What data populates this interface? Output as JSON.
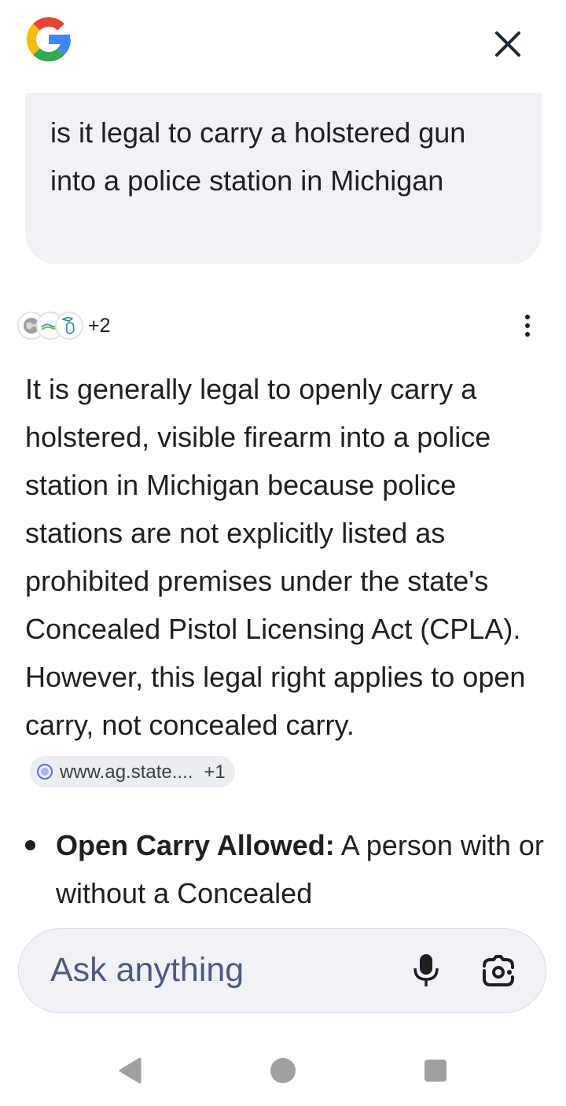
{
  "header": {
    "logo_icon": "google-g-icon",
    "close_icon": "close-icon"
  },
  "query": {
    "text": "is it legal to carry a holstered gun into a police station in Michigan"
  },
  "sources": {
    "icons": [
      "globe-icon",
      "ag-state-logo-icon",
      "michigan-map-icon"
    ],
    "extra_count": "+2"
  },
  "answer": {
    "paragraph": "It is generally legal to openly carry a holstered, visible firearm into a police station in Michigan because police stations are not explicitly listed as prohibited premises under the state's Concealed Pistol Licensing Act (CPLA). However, this legal right applies to open carry, not concealed carry.",
    "citation": {
      "label": "www.ag.state....",
      "extra": "+1"
    }
  },
  "bullets": [
    {
      "heading": "Open Carry Allowed:",
      "text": " A person with or without a Concealed"
    }
  ],
  "input": {
    "placeholder": "Ask anything",
    "mic_icon": "microphone-icon",
    "lens_icon": "google-lens-icon"
  },
  "navigation": {
    "back_icon": "back-triangle-icon",
    "home_icon": "home-circle-icon",
    "recents_icon": "recents-square-icon"
  },
  "colors": {
    "bubble_bg": "#f0f2f7",
    "chip_bg": "#eaedf2",
    "placeholder_text": "#4f5a80",
    "nav_icon": "#a0a0a0"
  }
}
